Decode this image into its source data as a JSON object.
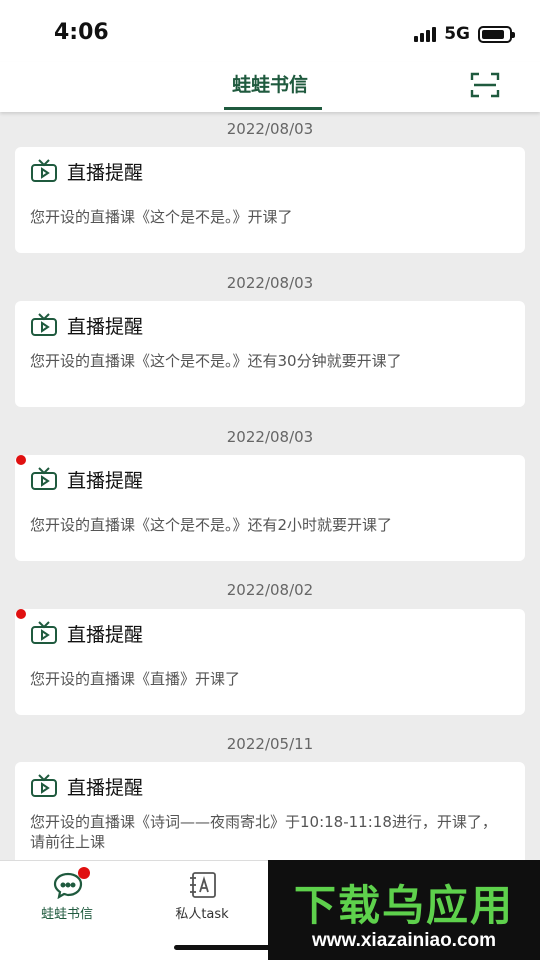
{
  "status_bar": {
    "time": "4:06",
    "network": "5G"
  },
  "header": {
    "title": "蛙蛙书信",
    "scan_icon": "scan-icon"
  },
  "notifications": [
    {
      "date": "2022/08/03",
      "title": "直播提醒",
      "message": "您开设的直播课《这个是不是。》开课了",
      "unread": false
    },
    {
      "date": "2022/08/03",
      "title": "直播提醒",
      "message": "您开设的直播课《这个是不是。》还有30分钟就要开课了",
      "unread": false
    },
    {
      "date": "2022/08/03",
      "title": "直播提醒",
      "message": "您开设的直播课《这个是不是。》还有2小时就要开课了",
      "unread": true
    },
    {
      "date": "2022/08/02",
      "title": "直播提醒",
      "message": "您开设的直播课《直播》开课了",
      "unread": true
    },
    {
      "date": "2022/05/11",
      "title": "直播提醒",
      "message": "您开设的直播课《诗词——夜雨寄北》于10:18-11:18进行，开课了，请前往上课",
      "unread": false
    }
  ],
  "tabs": [
    {
      "label": "蛙蛙书信",
      "icon": "chat-bubble-icon",
      "active": true,
      "badge": true
    },
    {
      "label": "私人task",
      "icon": "task-icon",
      "active": false,
      "badge": false
    }
  ],
  "watermark": {
    "logo": "下载乌应用",
    "url": "www.xiazainiao.com"
  },
  "colors": {
    "accent": "#1f5a3e",
    "badge": "#e01010",
    "background": "#ececec"
  }
}
